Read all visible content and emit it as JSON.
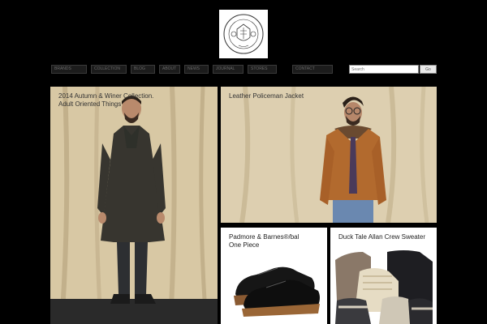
{
  "logo": {
    "icon": "crest-seal-icon",
    "alt": "brand crest"
  },
  "nav": {
    "items": [
      {
        "label": "Brands"
      },
      {
        "label": "Collection"
      },
      {
        "label": "Blog"
      },
      {
        "label": "About"
      },
      {
        "label": "News"
      },
      {
        "label": "Journal"
      },
      {
        "label": "Stores"
      },
      {
        "label": "Contact"
      }
    ]
  },
  "search": {
    "placeholder": "Search",
    "button_label": "Go"
  },
  "tiles": [
    {
      "caption": "2014 Autumn & Winer Collection.\nAdult Oriented Things"
    },
    {
      "caption": "Leather Policeman Jacket"
    },
    {
      "caption": "Padmore & Barnes®/bal\nOne Piece"
    },
    {
      "caption": "Duck Tale Allan Crew Sweater"
    }
  ],
  "colors": {
    "background": "#000000",
    "backdrop": "#d8c8a4",
    "jacket_leather": "#b26a2e"
  }
}
